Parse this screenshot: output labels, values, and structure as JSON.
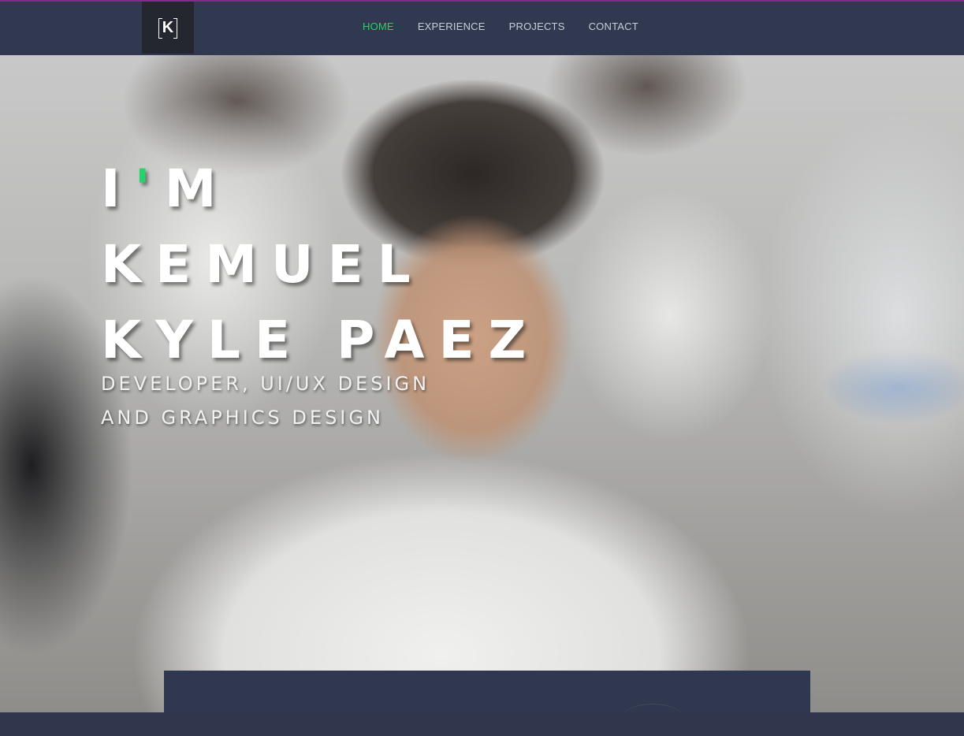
{
  "logo": {
    "letter": "K",
    "icon": "k-bracket-logo-icon"
  },
  "nav": {
    "items": [
      {
        "label": "HOME",
        "active": true
      },
      {
        "label": "EXPERIENCE",
        "active": false
      },
      {
        "label": "PROJECTS",
        "active": false
      },
      {
        "label": "CONTACT",
        "active": false
      }
    ]
  },
  "hero": {
    "title_line1_prefix": "I",
    "title_line1_apostrophe": "'",
    "title_line1_suffix": "M",
    "title_line2": "KEMUEL",
    "title_line3": "KYLE PAEZ",
    "subtitle_line1": "DEVELOPER, UI/UX DESIGN",
    "subtitle_line2": "AND GRAPHICS DESIGN"
  },
  "colors": {
    "accent": "#27d16b",
    "navbar": "#30394f",
    "topline": "#8a2a86",
    "panel": "#30384f"
  }
}
